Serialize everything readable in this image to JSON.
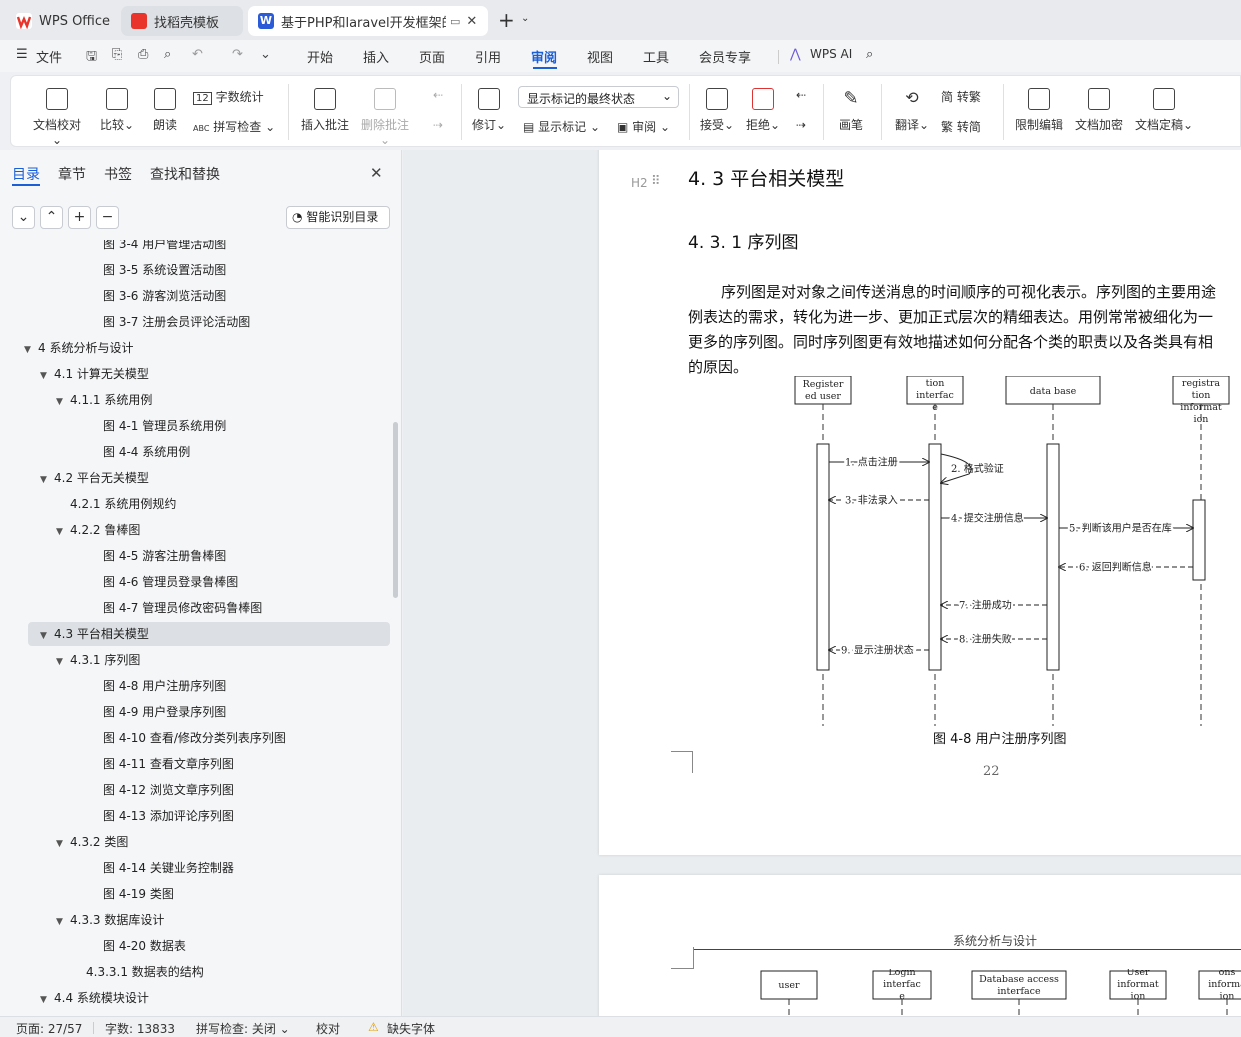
{
  "titlebar": {
    "tabs": [
      "WPS Office",
      "找稻壳模板",
      "基于PHP和laravel开发框架的("
    ]
  },
  "menubar": {
    "file": "文件",
    "items": [
      "开始",
      "插入",
      "页面",
      "引用",
      "审阅",
      "视图",
      "工具",
      "会员专享"
    ],
    "ai": "WPS AI",
    "active": "审阅"
  },
  "ribbon": {
    "doc_check": "文档校对",
    "compare": "比较",
    "read_aloud": "朗读",
    "word_count": "字数统计",
    "spell_check": "拼写检查",
    "insert_comment": "插入批注",
    "delete_comment": "删除批注",
    "revise": "修订",
    "markup_state": "显示标记的最终状态",
    "show_markup": "显示标记",
    "review": "审阅",
    "accept": "接受",
    "reject": "拒绝",
    "pen": "画笔",
    "translate": "翻译",
    "to_traditional": "转繁",
    "to_simplified": "转简",
    "restrict_edit": "限制编辑",
    "encrypt": "文档加密",
    "finalize": "文档定稿"
  },
  "nav": {
    "tabs": [
      "目录",
      "章节",
      "书签",
      "查找和替换"
    ],
    "smart_toc": "智能识别目录",
    "items": [
      {
        "text": "图 3-4 用户管理活动图",
        "level": 4
      },
      {
        "text": "图 3-5  系统设置活动图",
        "level": 4
      },
      {
        "text": "图 3-6  游客浏览活动图",
        "level": 4
      },
      {
        "text": "图 3-7  注册会员评论活动图",
        "level": 4
      },
      {
        "text": "4  系统分析与设计",
        "level": 1,
        "exp": true
      },
      {
        "text": "4.1 计算无关模型",
        "level": 2,
        "exp": true
      },
      {
        "text": "4.1.1 系统用例",
        "level": 3,
        "exp": true
      },
      {
        "text": "图 4-1  管理员系统用例",
        "level": 4
      },
      {
        "text": "图 4-4  系统用例",
        "level": 4
      },
      {
        "text": "4.2 平台无关模型",
        "level": 2,
        "exp": true
      },
      {
        "text": "4.2.1 系统用例规约",
        "level": 3
      },
      {
        "text": "4.2.2 鲁棒图",
        "level": 3,
        "exp": true
      },
      {
        "text": "图 4-5  游客注册鲁棒图",
        "level": 4
      },
      {
        "text": "图 4-6  管理员登录鲁棒图",
        "level": 4
      },
      {
        "text": "图 4-7  管理员修改密码鲁棒图",
        "level": 4
      },
      {
        "text": "4.3 平台相关模型",
        "level": 2,
        "exp": true,
        "sel": true
      },
      {
        "text": "4.3.1 序列图",
        "level": 3,
        "exp": true
      },
      {
        "text": "图 4-8  用户注册序列图",
        "level": 4
      },
      {
        "text": "图 4-9  用户登录序列图",
        "level": 4
      },
      {
        "text": "图 4-10  查看/修改分类列表序列图",
        "level": 4
      },
      {
        "text": "图 4-11  查看文章序列图",
        "level": 4
      },
      {
        "text": "图 4-12  浏览文章序列图",
        "level": 4
      },
      {
        "text": "图 4-13  添加评论序列图",
        "level": 4
      },
      {
        "text": "4.3.2 类图",
        "level": 3,
        "exp": true
      },
      {
        "text": "图 4-14  关键业务控制器",
        "level": 4
      },
      {
        "text": "图 4-19  类图",
        "level": 4
      },
      {
        "text": "4.3.3 数据库设计",
        "level": 3,
        "exp": true
      },
      {
        "text": "图 4-20  数据表",
        "level": 4
      },
      {
        "text": "4.3.3.1 数据表的结构",
        "level": 3.5
      },
      {
        "text": "4.4 系统模块设计",
        "level": 2,
        "exp": true
      }
    ]
  },
  "doc": {
    "h2": "4. 3 平台相关模型",
    "h3": "4. 3. 1 序列图",
    "h2_marker": "H2",
    "para": [
      "序列图是对对象之间传送消息的时间顺序的可视化表示。序列图的主要用途",
      "例表达的需求，转化为进一步、更加正式层次的精细表达。用例常常被细化为一",
      "更多的序列图。同时序列图更有效地描述如何分配各个类的职责以及各类具有相",
      "的原因。"
    ],
    "caption": "图 4-8  用户注册序列图",
    "page_no": "22",
    "header2": "系统分析与设计",
    "diagram": {
      "lifelines": [
        "Register\ned user",
        "tion\ninterfac\ne",
        "data base",
        "registra\ntion\ninformat\nion"
      ],
      "msgs": [
        "1. 点击注册",
        "2. 格式验证",
        "3. 非法录入",
        "4. 提交注册信息",
        "5. 判断该用户是否在库",
        "6. 返回判断信息",
        "7. 注册成功",
        "8. 注册失败",
        "9. 显示注册状态"
      ]
    },
    "diagram2": [
      "user",
      "Login\ninterfac\ne",
      "Database access\ninterface",
      "User\ninformat\nion",
      "ons\ninforma\nion"
    ]
  },
  "status": {
    "page": "页面: 27/57",
    "words": "字数: 13833",
    "spell": "拼写检查: 关闭",
    "proof": "校对",
    "font": "缺失字体"
  }
}
